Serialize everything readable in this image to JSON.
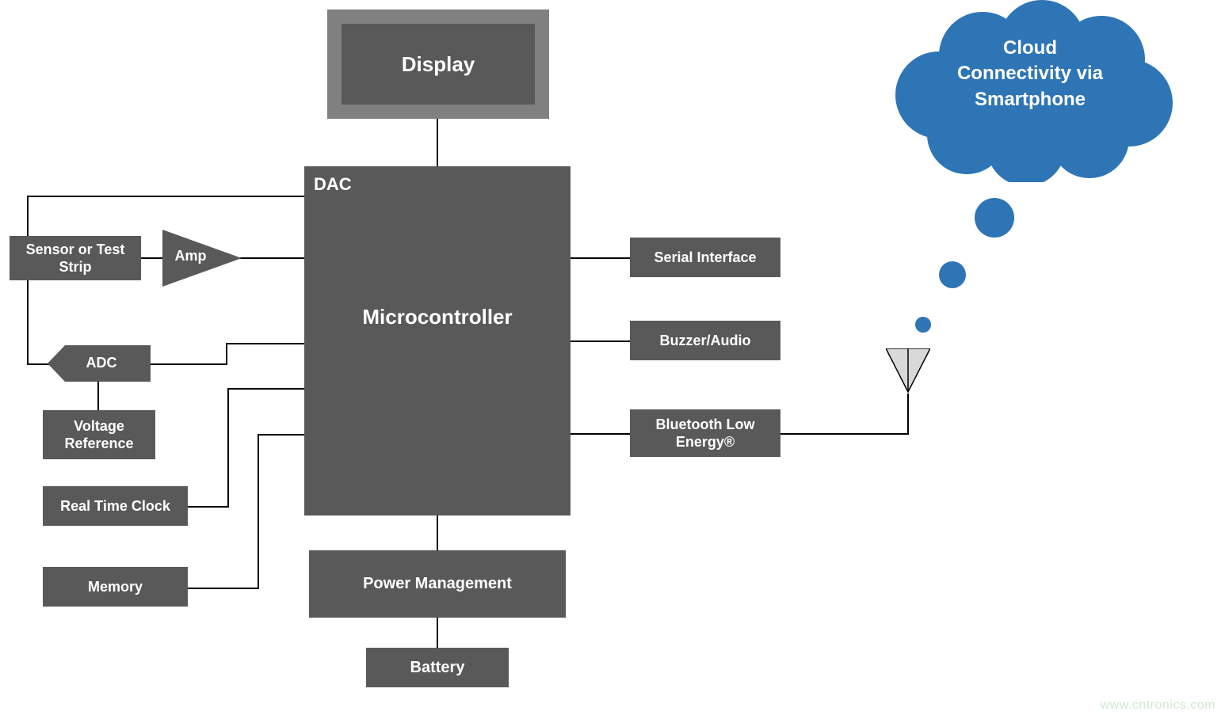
{
  "blocks": {
    "display": "Display",
    "microcontroller": "Microcontroller",
    "dac": "DAC",
    "sensor": "Sensor or Test Strip",
    "amp": "Amp",
    "adc": "ADC",
    "voltage_ref": "Voltage Reference",
    "rtc": "Real Time Clock",
    "memory": "Memory",
    "serial": "Serial Interface",
    "buzzer": "Buzzer/Audio",
    "ble": "Bluetooth Low Energy®",
    "power_mgmt": "Power Management",
    "battery": "Battery"
  },
  "cloud": {
    "line1": "Cloud",
    "line2": "Connectivity via",
    "line3": "Smartphone"
  },
  "watermark": "www.cntronics.com"
}
